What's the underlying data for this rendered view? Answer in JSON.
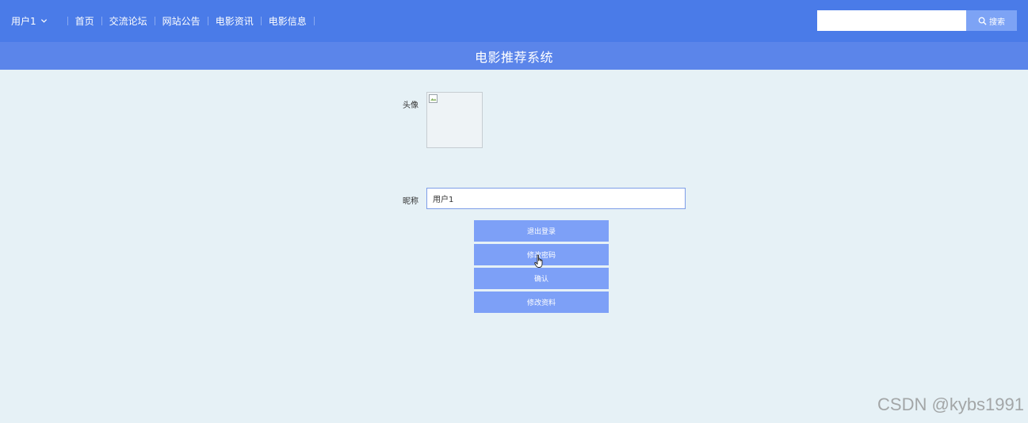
{
  "header": {
    "user_menu_label": "用户1",
    "nav_items": [
      "首页",
      "交流论坛",
      "网站公告",
      "电影资讯",
      "电影信息"
    ],
    "search_placeholder": "",
    "search_button_label": "搜索"
  },
  "banner": {
    "title": "电影推荐系统"
  },
  "profile": {
    "avatar_label": "头像",
    "nickname_label": "昵称",
    "nickname_value": "用户1",
    "buttons": {
      "logout": "退出登录",
      "change_password": "修改密码",
      "confirm": "确认",
      "edit_profile": "修改资料"
    }
  },
  "watermark": "CSDN @kybs1991",
  "colors": {
    "topbar": "#4a7be8",
    "banner": "#5b85ea",
    "button": "#7da0f7",
    "page_background": "#e6f1f6"
  }
}
